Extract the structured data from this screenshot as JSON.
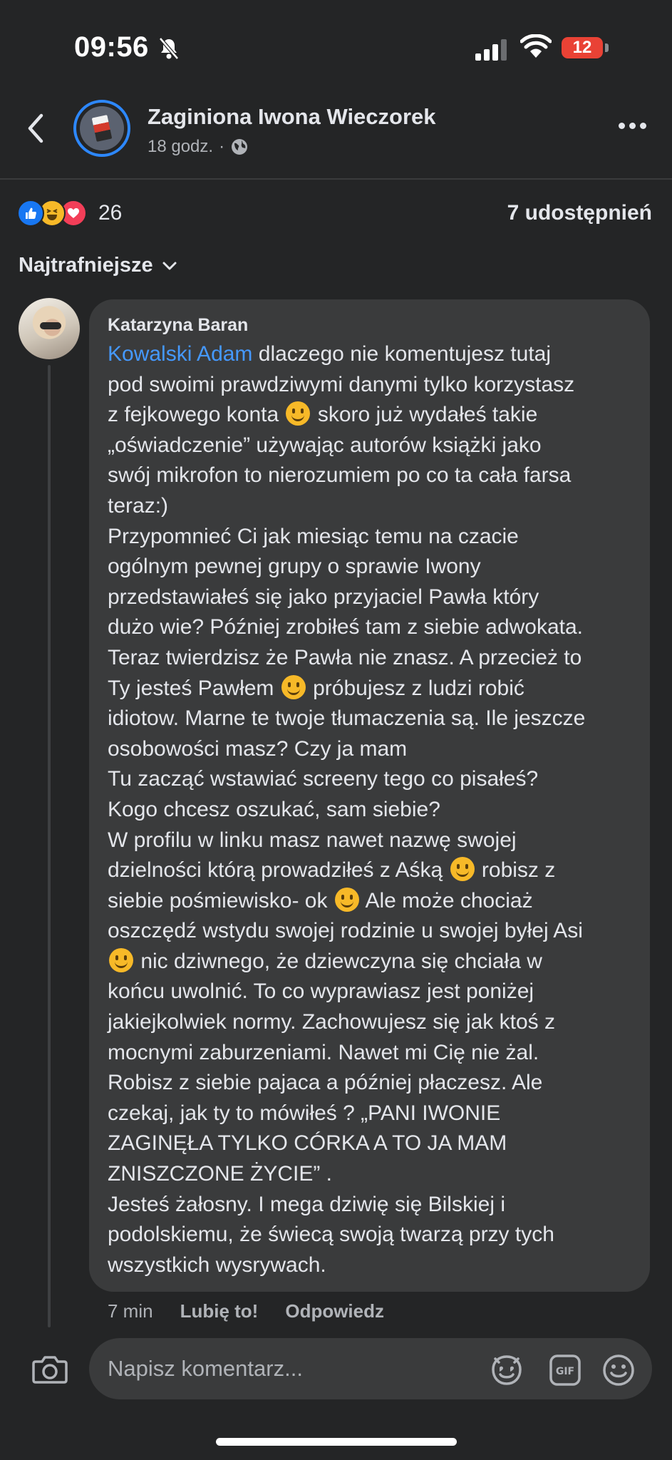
{
  "status_bar": {
    "time": "09:56",
    "battery": "12"
  },
  "header": {
    "title": "Zaginiona Iwona Wieczorek",
    "time_ago": "18 godz.",
    "separator": "·"
  },
  "reactions": {
    "count": "26",
    "shares": "7 udostępnień"
  },
  "sort": {
    "label": "Najtrafniejsze"
  },
  "comment": {
    "author": "Katarzyna Baran",
    "mention": "Kowalski Adam",
    "body": [
      " dlaczego nie komentujesz tutaj",
      "pod swoimi prawdziwymi danymi tylko korzystasz",
      "z fejkowego konta ",
      " skoro już wydałeś takie",
      "„oświadczenie” używając autorów książki jako",
      "swój mikrofon to nierozumiem po co ta cała farsa",
      "teraz:)",
      "Przypomnieć Ci jak miesiąc temu na czacie",
      "ogólnym pewnej grupy o sprawie Iwony",
      "przedstawiałeś się jako przyjaciel Pawła który",
      "dużo wie? Później zrobiłeś tam z siebie adwokata.",
      "Teraz twierdzisz że Pawła nie znasz. A przecież to",
      "Ty jesteś Pawłem ",
      " próbujesz z ludzi robić",
      "idiotow. Marne te twoje tłumaczenia są. Ile jeszcze",
      "osobowości masz? Czy ja mam",
      "Tu zacząć wstawiać screeny tego co pisałeś?",
      "Kogo chcesz oszukać, sam siebie?",
      "W profilu w linku masz nawet nazwę swojej",
      "dzielności którą prowadziłeś z Aśką ",
      " robisz z",
      "siebie pośmiewisko- ok ",
      " Ale może chociaż",
      "oszczędź wstydu swojej rodzinie u swojej byłej Asi",
      " nic dziwnego, że dziewczyna się chciała w",
      "końcu uwolnić. To co wyprawiasz jest poniżej",
      "jakiejkolwiek normy. Zachowujesz się jak ktoś z",
      "mocnymi zaburzeniami. Nawet mi Cię nie żal.",
      "Robisz z siebie pajaca a później płaczesz. Ale",
      "czekaj, jak ty to mówiłeś ? „PANI IWONIE",
      "ZAGINĘŁA TYLKO CÓRKA A TO JA MAM",
      "ZNISZCZONE ŻYCIE” .",
      "Jesteś żałosny. I mega dziwię się Bilskiej i",
      "podolskiemu, że świecą swoją twarzą przy tych",
      "wszystkich wysrywach."
    ],
    "time": "7 min",
    "like": "Lubię to!",
    "reply": "Odpowiedz"
  },
  "composer": {
    "placeholder": "Napisz komentarz..."
  },
  "icons": {
    "status": [
      "bell-slash-icon",
      "signal-icon",
      "wifi-icon",
      "battery-icon"
    ],
    "header": [
      "back-icon",
      "globe-icon",
      "more-icon"
    ],
    "reactions": [
      "like-icon",
      "haha-icon",
      "love-icon"
    ],
    "composer": [
      "camera-icon",
      "sticker-icon",
      "gif-icon",
      "emoji-icon"
    ]
  },
  "colors": {
    "background": "#242526",
    "bubble": "#3a3b3c",
    "mention": "#4599ff",
    "accent": "#2d88ff",
    "secondary_text": "#b0b3b8"
  }
}
